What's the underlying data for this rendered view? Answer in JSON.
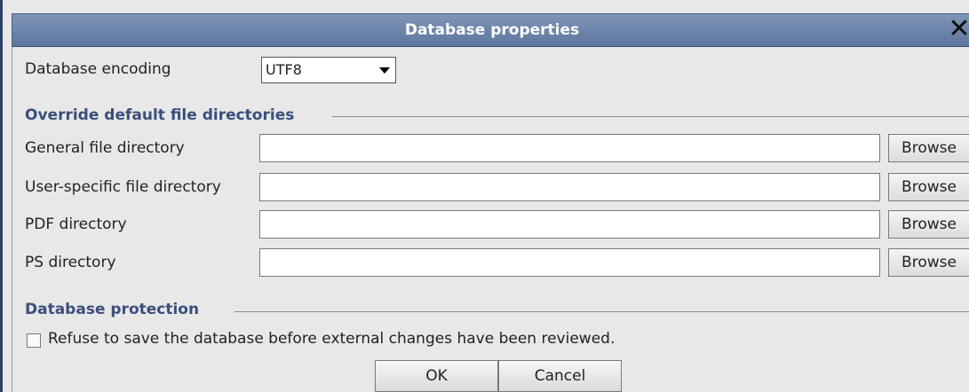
{
  "window": {
    "title": "Database properties",
    "close_glyph": "✕"
  },
  "encoding": {
    "label": "Database encoding",
    "selected": "UTF8"
  },
  "directories": {
    "section_title": "Override default file directories",
    "rows": [
      {
        "label": "General file directory",
        "value": "",
        "button": "Browse"
      },
      {
        "label": "User-specific file directory",
        "value": "",
        "button": "Browse"
      },
      {
        "label": "PDF directory",
        "value": "",
        "button": "Browse"
      },
      {
        "label": "PS directory",
        "value": "",
        "button": "Browse"
      }
    ]
  },
  "protection": {
    "section_title": "Database protection",
    "checkbox_label": "Refuse to save the database before external changes have been reviewed.",
    "checked": false
  },
  "buttons": {
    "ok": "OK",
    "cancel": "Cancel"
  },
  "colors": {
    "titlebar": "#6f86ad",
    "section_title": "#3a4f7c"
  }
}
